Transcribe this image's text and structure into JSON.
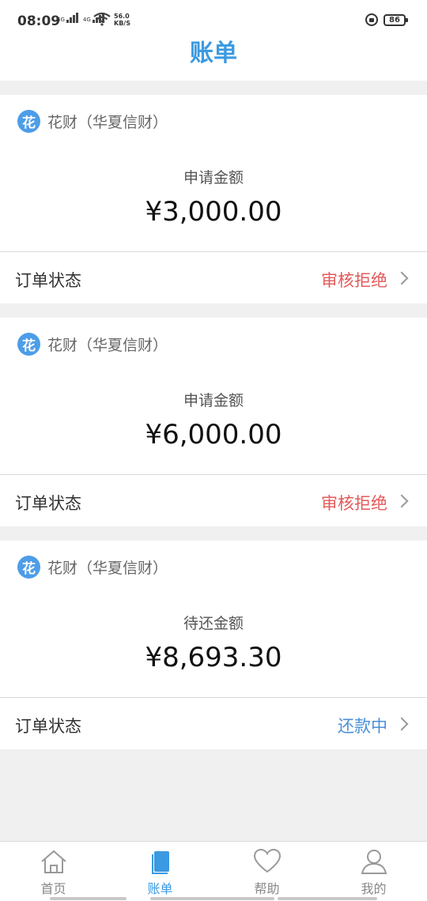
{
  "status_bar": {
    "time": "08:09",
    "network1": "4G",
    "network2": "4G",
    "speed_value": "56.0",
    "speed_unit": "KB/S",
    "battery": "86"
  },
  "header": {
    "title": "账单"
  },
  "bills": [
    {
      "bank_icon_char": "花",
      "bank_name": "花财（华夏信财）",
      "amount_label": "申请金额",
      "amount": "¥3,000.00",
      "status_label": "订单状态",
      "status": "审核拒绝",
      "status_color": "#e35a5a"
    },
    {
      "bank_icon_char": "花",
      "bank_name": "花财（华夏信财）",
      "amount_label": "申请金额",
      "amount": "¥6,000.00",
      "status_label": "订单状态",
      "status": "审核拒绝",
      "status_color": "#e35a5a"
    },
    {
      "bank_icon_char": "花",
      "bank_name": "花财（华夏信财）",
      "amount_label": "待还金额",
      "amount": "¥8,693.30",
      "status_label": "订单状态",
      "status": "还款中",
      "status_color": "#4a8fd6"
    }
  ],
  "tabs": [
    {
      "label": "首页",
      "icon": "home-icon",
      "active": false
    },
    {
      "label": "账单",
      "icon": "bill-icon",
      "active": true
    },
    {
      "label": "帮助",
      "icon": "heart-icon",
      "active": false
    },
    {
      "label": "我的",
      "icon": "user-icon",
      "active": false
    }
  ],
  "colors": {
    "accent": "#3b9ae1",
    "rejected": "#e35a5a",
    "repaying": "#4a8fd6",
    "background": "#f0f0f0"
  }
}
